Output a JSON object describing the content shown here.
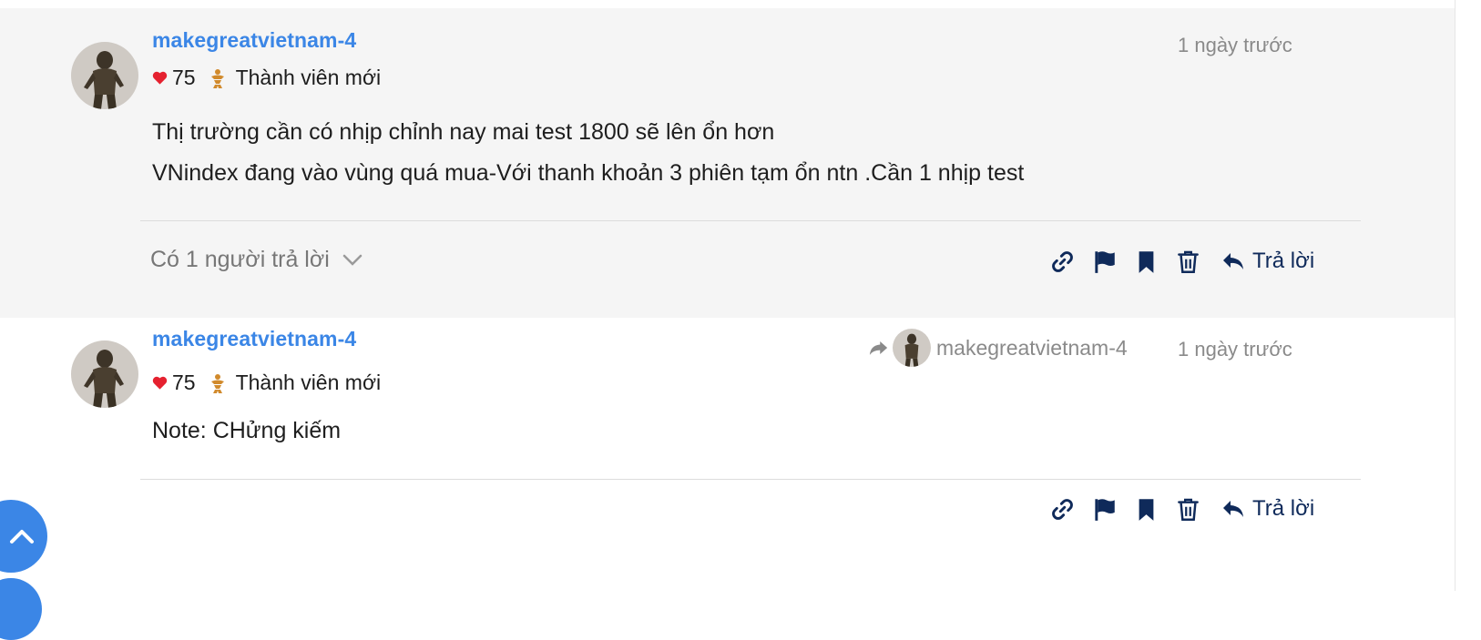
{
  "posts": [
    {
      "author": "makegreatvietnam-4",
      "likes": "75",
      "rank": "Thành viên mới",
      "time": "1 ngày trước",
      "lines": [
        "Thị trường cần có nhịp chỉnh nay mai test 1800 sẽ lên ổn hơn",
        "VNindex đang vào vùng quá mua-Với thanh khoản 3 phiên tạm ổn ntn .Cần 1 nhịp test"
      ],
      "replies_label": "Có 1 người trả lời",
      "reply_label": "Trả lời"
    },
    {
      "author": "makegreatvietnam-4",
      "likes": "75",
      "rank": "Thành viên mới",
      "time": "1 ngày trước",
      "reply_to": "makegreatvietnam-4",
      "lines": [
        "Note: CHửng kiếm"
      ],
      "reply_label": "Trả lời"
    }
  ],
  "colors": {
    "accent": "#3b86e6",
    "heart": "#e5212f",
    "rank_badge": "#d18a2c",
    "icon": "#0f2a5a",
    "muted": "#8a8a8a"
  },
  "icons": [
    "heart-icon",
    "rank-badge-icon",
    "chevron-down-icon",
    "link-icon",
    "flag-icon",
    "bookmark-icon",
    "trash-icon",
    "reply-icon",
    "share-icon",
    "scroll-up-icon"
  ]
}
